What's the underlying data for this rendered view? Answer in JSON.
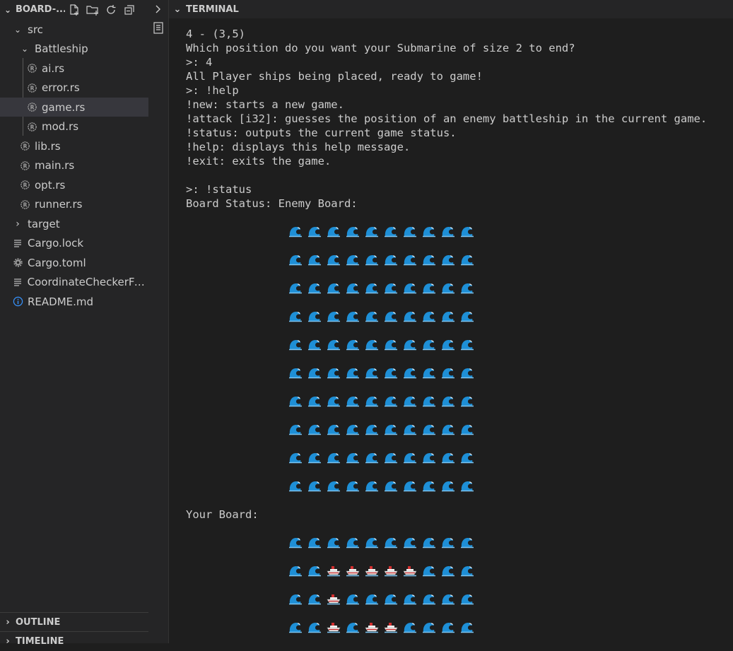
{
  "explorer": {
    "title": "BOARD-...",
    "items": [
      {
        "label": "src",
        "type": "folder-open",
        "indent": 1
      },
      {
        "label": "Battleship",
        "type": "folder-open",
        "indent": 2
      },
      {
        "label": "ai.rs",
        "type": "rust",
        "indent": 3
      },
      {
        "label": "error.rs",
        "type": "rust",
        "indent": 3
      },
      {
        "label": "game.rs",
        "type": "rust",
        "indent": 3,
        "selected": true
      },
      {
        "label": "mod.rs",
        "type": "rust",
        "indent": 3
      },
      {
        "label": "lib.rs",
        "type": "rust",
        "indent": 2
      },
      {
        "label": "main.rs",
        "type": "rust",
        "indent": 2
      },
      {
        "label": "opt.rs",
        "type": "rust",
        "indent": 2
      },
      {
        "label": "runner.rs",
        "type": "rust",
        "indent": 2
      },
      {
        "label": "target",
        "type": "folder-closed",
        "indent": 1
      },
      {
        "label": "Cargo.lock",
        "type": "lines",
        "indent": 1
      },
      {
        "label": "Cargo.toml",
        "type": "gear",
        "indent": 1
      },
      {
        "label": "CoordinateCheckerFu...",
        "type": "lines",
        "indent": 1
      },
      {
        "label": "README.md",
        "type": "info",
        "indent": 1
      }
    ]
  },
  "panels": {
    "outline": "OUTLINE",
    "timeline": "TIMELINE"
  },
  "terminal": {
    "title": "TERMINAL",
    "lines": [
      "4 - (3,5)",
      "Which position do you want your Submarine of size 2 to end?",
      ">: 4",
      "All Player ships being placed, ready to game!",
      ">: !help",
      "!new: starts a new game.",
      "!attack [i32]: guesses the position of an enemy battleship in the current game.",
      "!status: outputs the current game status.",
      "!help: displays this help message.",
      "!exit: exits the game.",
      "",
      ">: !status",
      "Board Status: Enemy Board:"
    ],
    "your_board_label": "Your Board:",
    "enemy_board": [
      "WWWWWWWWWW",
      "WWWWWWWWWW",
      "WWWWWWWWWW",
      "WWWWWWWWWW",
      "WWWWWWWWWW",
      "WWWWWWWWWW",
      "WWWWWWWWWW",
      "WWWWWWWWWW",
      "WWWWWWWWWW",
      "WWWWWWWWWW"
    ],
    "your_board": [
      "WWWWWWWWWW",
      "WWSSSSSWWW",
      "WWSWWWWWWW",
      "WWSWSSWWWW"
    ]
  },
  "colors": {
    "wave": "#1e8fd6",
    "ship_hull": "#f2f2f2",
    "ship_stripe": "#c62828",
    "rust_icon": "#a0a0a0"
  }
}
